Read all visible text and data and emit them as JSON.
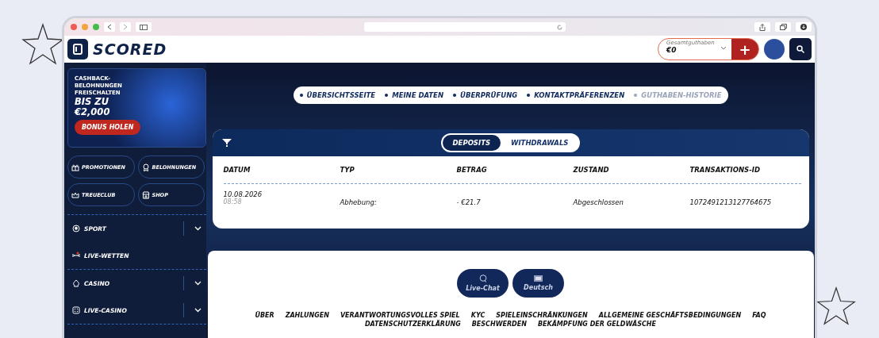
{
  "header": {
    "logo": "SCORED",
    "balance": {
      "label": "Gesamtguthaben",
      "value": "€0"
    },
    "deposit_button": "+"
  },
  "promo": {
    "text": "CASHBACK-BELOHNUNGEN FREISCHALTEN",
    "amount": "BIS ZU €2,000",
    "button": "BONUS HOLEN"
  },
  "quick_links": [
    {
      "label": "PROMOTIONEN",
      "kind": "gift"
    },
    {
      "label": "BELOHNUNGEN",
      "kind": "medal"
    },
    {
      "label": "TREUECLUB",
      "kind": "crown"
    },
    {
      "label": "SHOP",
      "kind": "shop"
    }
  ],
  "menu": [
    {
      "label": "SPORT",
      "kind": "ball",
      "expandable": true,
      "group_end": false
    },
    {
      "label": "LIVE-WETTEN",
      "kind": "live",
      "expandable": false,
      "group_end": true
    },
    {
      "label": "CASINO",
      "kind": "spade",
      "expandable": true,
      "group_end": false
    },
    {
      "label": "LIVE-CASINO",
      "kind": "dice",
      "expandable": true,
      "group_end": true
    }
  ],
  "account_nav": [
    {
      "label": "ÜBERSICHTSSEITE",
      "disabled": false
    },
    {
      "label": "MEINE DATEN",
      "disabled": false
    },
    {
      "label": "ÜBERPRÜFUNG",
      "disabled": false
    },
    {
      "label": "KONTAKTPRÄFERENZEN",
      "disabled": false
    },
    {
      "label": "GUTHABEN-HISTORIE",
      "disabled": true
    }
  ],
  "tabs": [
    {
      "label": "DEPOSITS",
      "selected": true
    },
    {
      "label": "WITHDRAWALS",
      "selected": false
    }
  ],
  "table": {
    "columns": [
      "DATUM",
      "TYP",
      "BETRAG",
      "ZUSTAND",
      "TRANSAKTIONS-ID"
    ],
    "rows": [
      {
        "date": "10.08.2026",
        "time": "08:58",
        "type": "Abhebung:",
        "amount": "- €21.7",
        "status": "Abgeschlossen",
        "id": "1072491213127764675"
      }
    ]
  },
  "footer": {
    "buttons": [
      {
        "label": "Live-Chat",
        "kind": "chat"
      },
      {
        "label": "Deutsch",
        "kind": "flag"
      }
    ],
    "links": [
      "ÜBER",
      "ZAHLUNGEN",
      "VERANTWORTUNGSVOLLES SPIEL",
      "KYC",
      "SPIELEINSCHRÄNKUNGEN",
      "ALLGEMEINE GESCHÄFTSBEDINGUNGEN",
      "FAQ",
      "DATENSCHUTZERKLÄRUNG",
      "BESCHWERDEN",
      "BEKÄMPFUNG DER GELDWÄSCHE"
    ]
  }
}
